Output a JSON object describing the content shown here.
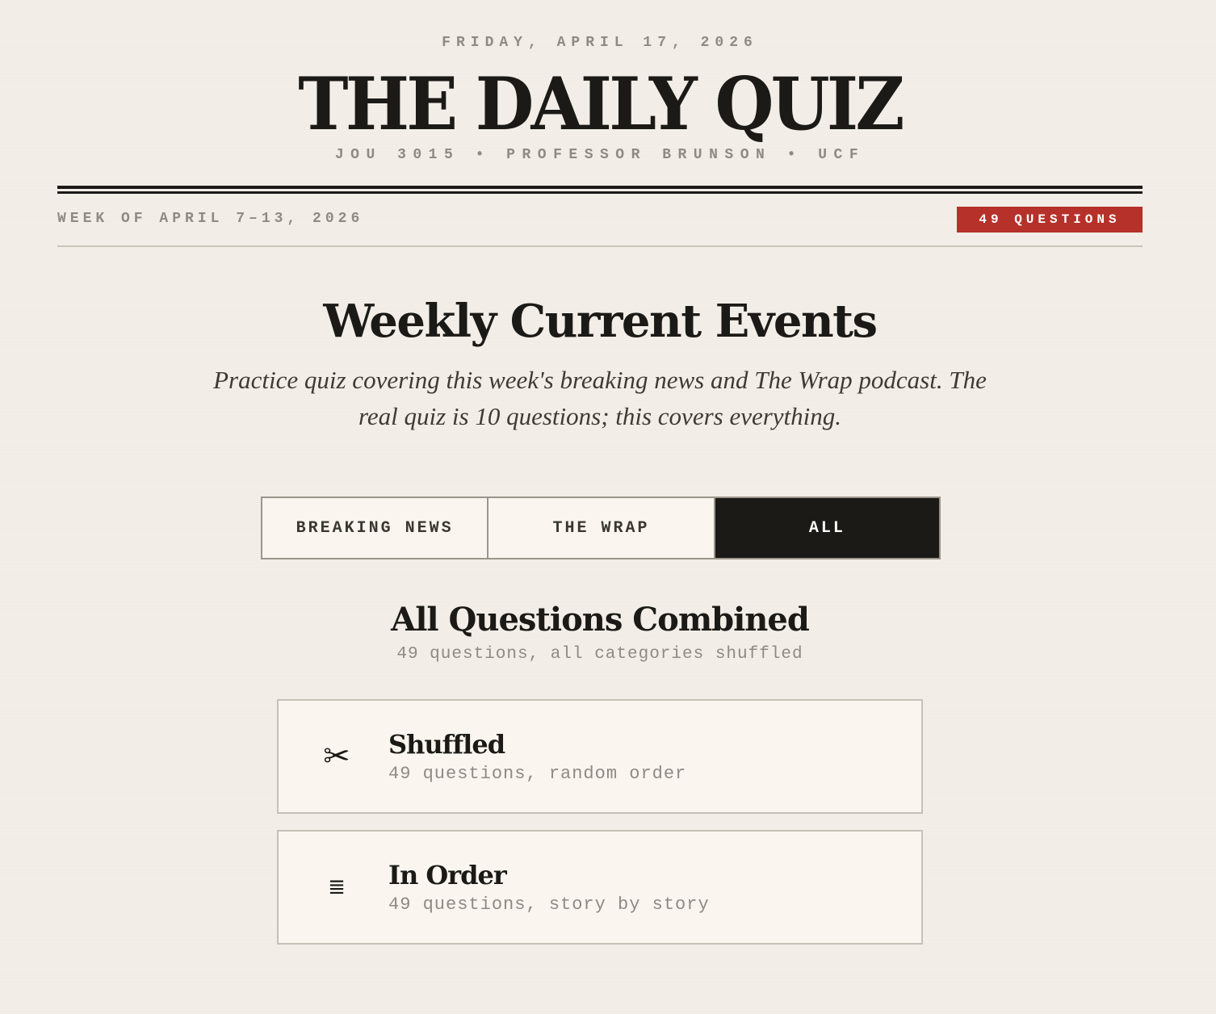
{
  "header": {
    "date": "FRIDAY, APRIL 17, 2026",
    "title": "THE DAILY QUIZ",
    "course": "JOU 3015 • PROFESSOR BRUNSON • UCF"
  },
  "subheader": {
    "week": "WEEK OF APRIL 7–13, 2026",
    "badge": "49 QUESTIONS"
  },
  "intro": {
    "title": "Weekly Current Events",
    "description": "Practice quiz covering this week's breaking news and The Wrap podcast. The real quiz is 10 questions; this covers everything."
  },
  "tabs": [
    {
      "label": "BREAKING NEWS",
      "active": false
    },
    {
      "label": "THE WRAP",
      "active": false
    },
    {
      "label": "ALL",
      "active": true
    }
  ],
  "mode": {
    "title": "All Questions Combined",
    "subtitle": "49 questions, all categories shuffled",
    "options": [
      {
        "icon": "scissors-icon",
        "glyph": "✂",
        "title": "Shuffled",
        "description": "49 questions, random order"
      },
      {
        "icon": "list-icon",
        "glyph": "≣",
        "title": "In Order",
        "description": "49 questions, story by story"
      }
    ]
  },
  "colors": {
    "background": "#f3eee7",
    "ink": "#1b1a17",
    "accent": "#b5312a",
    "muted": "#8f8a82"
  }
}
